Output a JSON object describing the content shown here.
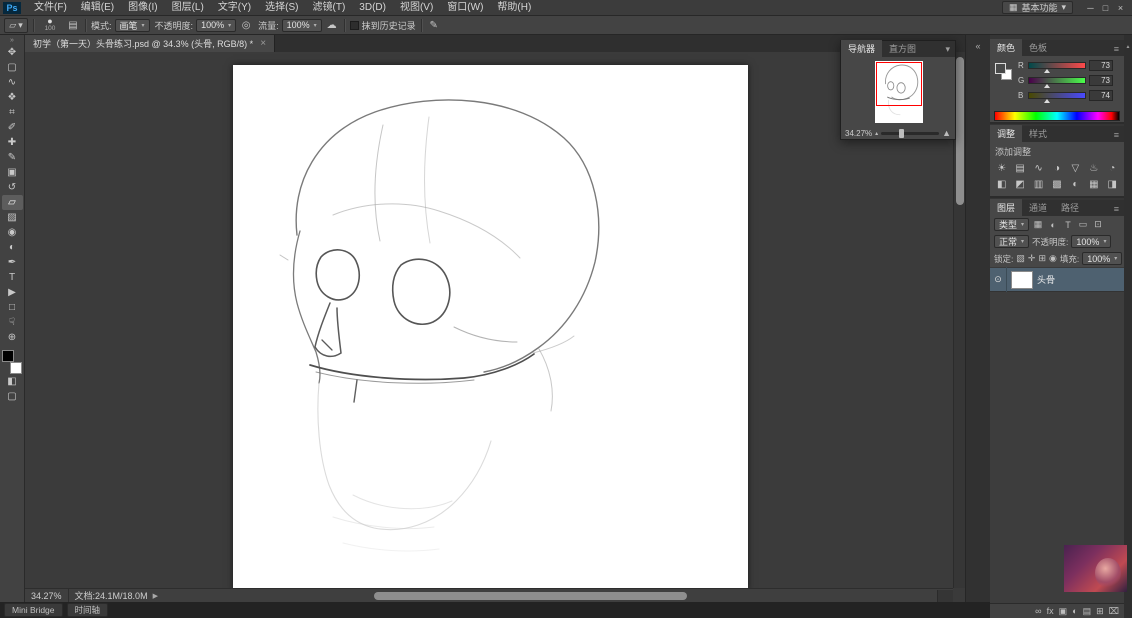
{
  "ui": {
    "caret": "▾",
    "menu_icon": "≡",
    "collapse_left": "«",
    "toolbar_chevrons": "»",
    "expand_arrow": "▶",
    "scroll_up_arrow": "▲",
    "slider_min_icon": "▴",
    "slider_max_icon": "▲",
    "panel_collapse_icon": "▾"
  },
  "app": {
    "logo": "Ps",
    "workspace": "基本功能",
    "workspace_icon": "▦",
    "window_controls": {
      "minimize": "─",
      "maximize": "□",
      "close": "×"
    }
  },
  "menubar": {
    "items": [
      {
        "label": "文件(F)"
      },
      {
        "label": "编辑(E)"
      },
      {
        "label": "图像(I)"
      },
      {
        "label": "图层(L)"
      },
      {
        "label": "文字(Y)"
      },
      {
        "label": "选择(S)"
      },
      {
        "label": "滤镜(T)"
      },
      {
        "label": "3D(D)"
      },
      {
        "label": "视图(V)"
      },
      {
        "label": "窗口(W)"
      },
      {
        "label": "帮助(H)"
      }
    ]
  },
  "options_bar": {
    "tool_glyph": "▱",
    "brush_preset": {
      "glyph": "●",
      "size": "100"
    },
    "panel_toggle_icon": "▤",
    "mode_label": "模式:",
    "mode_value": "画笔",
    "opacity_label": "不透明度:",
    "opacity_value": "100%",
    "tablet_icon": "◎",
    "flow_label": "流量:",
    "flow_value": "100%",
    "airbrush_icon": "☁",
    "erase_history_label": "抹到历史记录",
    "brush_panel_icon": "✎"
  },
  "document_tab": {
    "title": "初学（第一天）头骨练习.psd @ 34.3% (头骨, RGB/8) *",
    "close": "×"
  },
  "toolbar": {
    "tools": [
      {
        "name": "move-tool",
        "glyph": "✥"
      },
      {
        "name": "rectangular-marquee-tool",
        "glyph": "▢"
      },
      {
        "name": "lasso-tool",
        "glyph": "∿"
      },
      {
        "name": "quick-selection-tool",
        "glyph": "❖"
      },
      {
        "name": "crop-tool",
        "glyph": "⌗"
      },
      {
        "name": "eyedropper-tool",
        "glyph": "✐"
      },
      {
        "name": "healing-brush-tool",
        "glyph": "✚"
      },
      {
        "name": "brush-tool",
        "glyph": "✎"
      },
      {
        "name": "clone-stamp-tool",
        "glyph": "▣"
      },
      {
        "name": "history-brush-tool",
        "glyph": "↺"
      },
      {
        "name": "eraser-tool",
        "glyph": "▱"
      },
      {
        "name": "gradient-tool",
        "glyph": "▨"
      },
      {
        "name": "blur-tool",
        "glyph": "◉"
      },
      {
        "name": "dodge-tool",
        "glyph": "◐"
      },
      {
        "name": "pen-tool",
        "glyph": "✒"
      },
      {
        "name": "type-tool",
        "glyph": "T"
      },
      {
        "name": "path-selection-tool",
        "glyph": "▶"
      },
      {
        "name": "shape-tool",
        "glyph": "□"
      },
      {
        "name": "hand-tool",
        "glyph": "☟"
      },
      {
        "name": "zoom-tool",
        "glyph": "⊕"
      }
    ],
    "quick_mask_glyph": "◧",
    "screen_mode_glyph": "▢"
  },
  "navigator": {
    "tabs": [
      {
        "label": "导航器"
      },
      {
        "label": "直方图"
      }
    ],
    "zoom": "34.27%"
  },
  "color_panel": {
    "tabs": [
      {
        "label": "颜色"
      },
      {
        "label": "色板"
      }
    ],
    "channels": [
      {
        "label": "R",
        "value": "73"
      },
      {
        "label": "G",
        "value": "73"
      },
      {
        "label": "B",
        "value": "74"
      }
    ]
  },
  "adjustments_panel": {
    "tabs": [
      {
        "label": "调整"
      },
      {
        "label": "样式"
      }
    ],
    "add_label": "添加调整",
    "icons_row1": [
      {
        "name": "brightness-contrast",
        "glyph": "☀"
      },
      {
        "name": "levels",
        "glyph": "▤"
      },
      {
        "name": "curves",
        "glyph": "∿"
      },
      {
        "name": "exposure",
        "glyph": "◑"
      },
      {
        "name": "vibrance",
        "glyph": "▽"
      },
      {
        "name": "hue-saturation",
        "glyph": "♨"
      },
      {
        "name": "color-balance",
        "glyph": "◔"
      }
    ],
    "icons_row2": [
      {
        "name": "black-white",
        "glyph": "◧"
      },
      {
        "name": "photo-filter",
        "glyph": "◩"
      },
      {
        "name": "channel-mixer",
        "glyph": "▥"
      },
      {
        "name": "color-lookup",
        "glyph": "▩"
      },
      {
        "name": "invert",
        "glyph": "◐"
      },
      {
        "name": "posterize",
        "glyph": "▦"
      },
      {
        "name": "threshold",
        "glyph": "◨"
      }
    ]
  },
  "layers_panel": {
    "tabs": [
      {
        "label": "图层"
      },
      {
        "label": "通道"
      },
      {
        "label": "路径"
      }
    ],
    "filter_label": "类型",
    "filter_icons": [
      {
        "name": "filter-pixel-layers",
        "glyph": "▦"
      },
      {
        "name": "filter-adjustment-layers",
        "glyph": "◐"
      },
      {
        "name": "filter-type-layers",
        "glyph": "T"
      },
      {
        "name": "filter-shape-layers",
        "glyph": "▭"
      },
      {
        "name": "filter-smart-objects",
        "glyph": "⊡"
      }
    ],
    "blend_mode": "正常",
    "opacity_label": "不透明度:",
    "opacity_value": "100%",
    "lock_label": "锁定:",
    "lock_icons": [
      {
        "name": "lock-transparency",
        "glyph": "▧"
      },
      {
        "name": "lock-pixels",
        "glyph": "✛"
      },
      {
        "name": "lock-position",
        "glyph": "⊞"
      },
      {
        "name": "lock-all",
        "glyph": "◉"
      }
    ],
    "fill_label": "填充:",
    "fill_value": "100%",
    "rows": [
      {
        "name": "头骨",
        "eye": "⊙"
      }
    ],
    "bottom_icons": [
      {
        "name": "link-layers",
        "glyph": "∞"
      },
      {
        "name": "layer-effects",
        "glyph": "fx"
      },
      {
        "name": "layer-mask",
        "glyph": "▣"
      },
      {
        "name": "adjustment-layer",
        "glyph": "◐"
      },
      {
        "name": "layer-group",
        "glyph": "▤"
      },
      {
        "name": "new-layer",
        "glyph": "⊞"
      },
      {
        "name": "delete-layer",
        "glyph": "⌧"
      }
    ]
  },
  "status_bar": {
    "zoom": "34.27%",
    "doc_info": "文档:24.1M/18.0M"
  },
  "bottom_bar": {
    "mini_bridge_label": "Mini Bridge",
    "timeline_label": "时间轴"
  }
}
